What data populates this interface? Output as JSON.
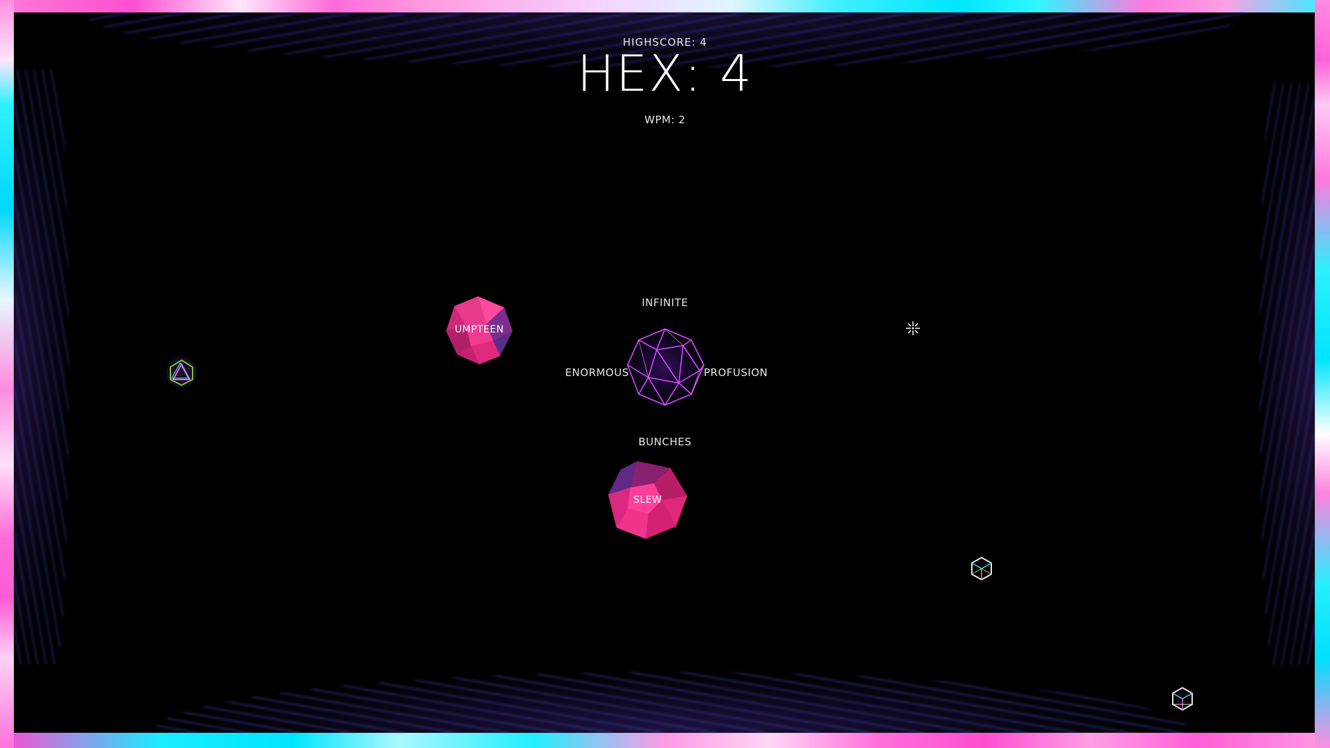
{
  "hud": {
    "highscore": "HIGHSCORE: 4",
    "hex": "HEX: 4",
    "wpm": "WPM: 2"
  },
  "choices": {
    "top": "INFINITE",
    "left": "ENORMOUS",
    "right": "PROFUSION",
    "bottom": "BUNCHES"
  },
  "enemies": [
    {
      "label": "UMPTEEN"
    },
    {
      "label": "SLEW"
    }
  ],
  "colors": {
    "gem_pink": "#e0287a",
    "gem_pink_light": "#ff4aa0",
    "gem_purple": "#6a2f8a",
    "wire_magenta": "#d34cff",
    "frame_cyan": "#00e5ff",
    "frame_pink": "#ff5ad6",
    "text": "#e8e8e8"
  },
  "icons": {
    "player": "wireframe-icosahedron-icon",
    "enemy": "faceted-gem-icon",
    "pickup": "small-wireframe-polyhedron-icon",
    "cursor": "crosshair-cursor-icon"
  }
}
